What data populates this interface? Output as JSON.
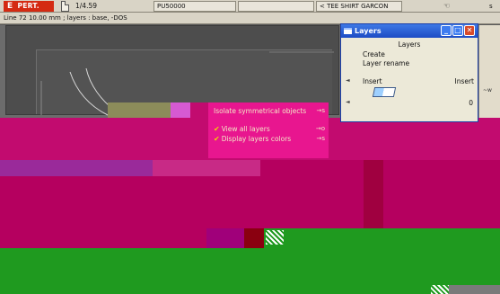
{
  "toolbar": {
    "app_badge": "PERT.",
    "badge_letter": "E",
    "page_count": "1/4.59",
    "model_code": "PU50000",
    "blank_field": "",
    "model_name": "< TEE SHIRT GARCON",
    "tool_icon": "☜",
    "right_letter": "s"
  },
  "status_line": "Line 72 10.00 mm ;   layers : base, -DOS",
  "context_menu": {
    "items": [
      {
        "label": "Isolate symmetrical objects",
        "shortcut": "→s",
        "checked": false
      },
      {
        "label": "View all layers",
        "shortcut": "→o",
        "checked": true
      },
      {
        "label": "Display layers colors",
        "shortcut": "→s",
        "checked": true
      }
    ]
  },
  "layers_window": {
    "title": "Layers",
    "heading": "Layers",
    "items": [
      "Create",
      "Layer rename"
    ],
    "row": {
      "left": "Insert",
      "right": "Insert"
    },
    "value": "0",
    "title_buttons": {
      "minimize": "_",
      "maximize": "□",
      "close": "✕"
    }
  },
  "right_strip_label": "~w",
  "icons": [
    "file-icon",
    "window-icon",
    "minimize-icon",
    "maximize-icon",
    "close-icon",
    "eraser-icon",
    "pointer-icon",
    "check-icon"
  ],
  "colors": {
    "accent_red": "#d42a12",
    "menu_magenta": "#e8168f",
    "glitch_magenta": "#c8006e",
    "glitch_green": "#1f9a1f",
    "title_blue": "#1d4bc4"
  }
}
